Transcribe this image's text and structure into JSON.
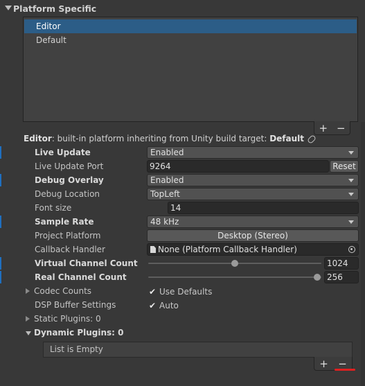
{
  "section": {
    "title": "Platform Specific"
  },
  "platform_list": {
    "items": [
      "Editor",
      "Default"
    ],
    "selected": "Editor"
  },
  "list_footer": {
    "add": "+",
    "remove": "−"
  },
  "info": {
    "prefix": "Editor",
    "text": ": built-in platform inheriting from Unity build target: ",
    "target": "Default"
  },
  "rows": {
    "live_update": {
      "label": "Live Update",
      "value": "Enabled"
    },
    "live_update_port": {
      "label": "Live Update Port",
      "value": "9264",
      "reset": "Reset"
    },
    "debug_overlay": {
      "label": "Debug Overlay",
      "value": "Enabled"
    },
    "debug_location": {
      "label": "Debug Location",
      "value": "TopLeft"
    },
    "font_size": {
      "label": "Font size",
      "value": "14"
    },
    "sample_rate": {
      "label": "Sample Rate",
      "value": "48 kHz"
    },
    "project_platform": {
      "label": "Project Platform",
      "value": "Desktop (Stereo)"
    },
    "callback_handler": {
      "label": "Callback Handler",
      "value": "None (Platform Callback Handler)"
    },
    "virtual_channel_count": {
      "label": "Virtual Channel Count",
      "value": "1024"
    },
    "real_channel_count": {
      "label": "Real Channel Count",
      "value": "256"
    },
    "codec_counts": {
      "label": "Codec Counts",
      "checkbox_label": "Use Defaults",
      "checked": true
    },
    "dsp_buffer": {
      "label": "DSP Buffer Settings",
      "checkbox_label": "Auto",
      "checked": true
    },
    "static_plugins": {
      "label": "Static Plugins: 0"
    },
    "dynamic_plugins": {
      "label": "Dynamic Plugins: 0",
      "empty_text": "List is Empty"
    }
  },
  "colors": {
    "selection": "#2c5d87",
    "override_marker": "#1f6fbf",
    "annotation": "#e02020"
  }
}
